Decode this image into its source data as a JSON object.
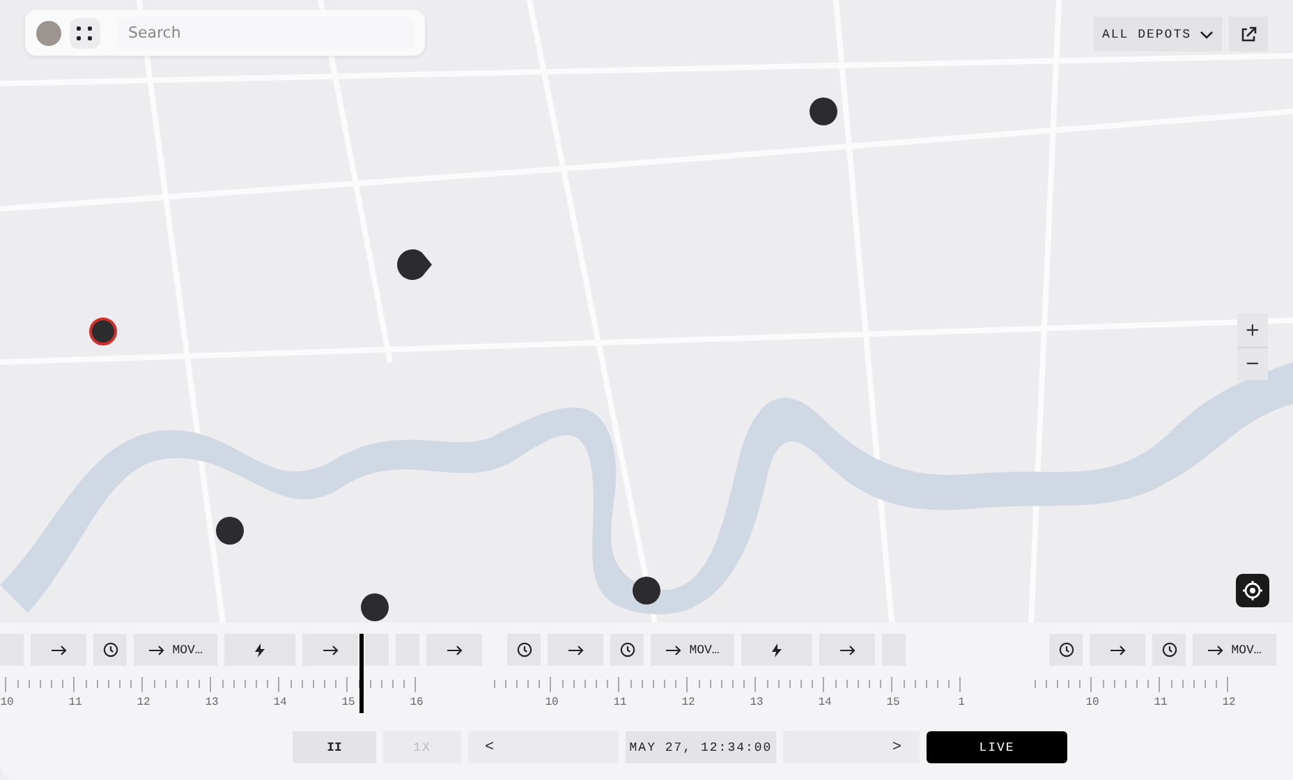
{
  "search": {
    "placeholder": "Search"
  },
  "depot_filter": {
    "label": "ALL DEPOTS"
  },
  "markers": [
    {
      "kind": "vehicle",
      "selected": false
    },
    {
      "kind": "heading",
      "selected": false
    },
    {
      "kind": "vehicle",
      "selected": true
    },
    {
      "kind": "vehicle",
      "selected": false
    },
    {
      "kind": "vehicle",
      "selected": false
    },
    {
      "kind": "vehicle",
      "selected": false
    }
  ],
  "zoom": {
    "in": "+",
    "out": "−"
  },
  "timeline": {
    "lanes": [
      {
        "events": [
          {
            "kind": "blank"
          },
          {
            "kind": "move"
          },
          {
            "kind": "wait"
          },
          {
            "kind": "move",
            "label": "MOV…"
          },
          {
            "kind": "charge"
          },
          {
            "kind": "move"
          },
          {
            "kind": "blank"
          },
          {
            "kind": "blank"
          },
          {
            "kind": "move"
          }
        ],
        "hours": [
          "10",
          "11",
          "12",
          "13",
          "14",
          "15",
          "16"
        ]
      },
      {
        "events": [
          {
            "kind": "wait"
          },
          {
            "kind": "move"
          },
          {
            "kind": "wait"
          },
          {
            "kind": "move",
            "label": "MOV…"
          },
          {
            "kind": "charge"
          },
          {
            "kind": "move"
          },
          {
            "kind": "blank"
          }
        ],
        "hours": [
          "10",
          "11",
          "12",
          "13",
          "14",
          "15",
          "1"
        ]
      },
      {
        "events": [
          {
            "kind": "wait"
          },
          {
            "kind": "move"
          },
          {
            "kind": "wait"
          },
          {
            "kind": "move",
            "label": "MOV…"
          }
        ],
        "hours": [
          "10",
          "11",
          "12"
        ]
      }
    ]
  },
  "playback": {
    "pause": "II",
    "speed": {
      "label": "1X",
      "disabled": true
    },
    "prev": "<",
    "time": "MAY 27, 12:34:00",
    "next": ">",
    "live": "LIVE"
  }
}
